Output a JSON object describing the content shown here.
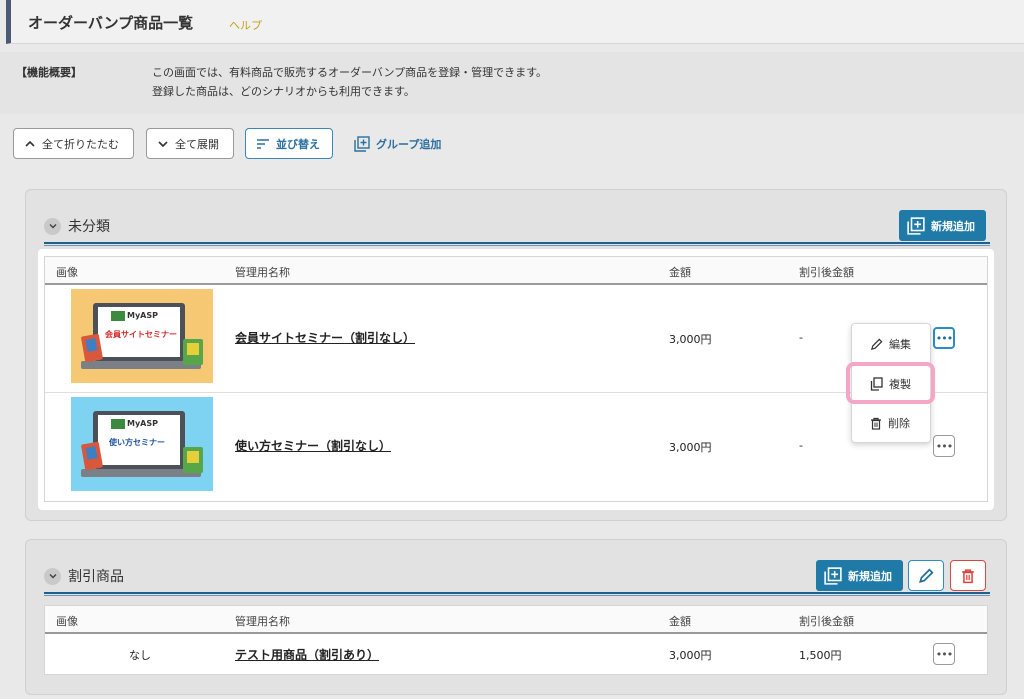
{
  "header": {
    "title": "オーダーバンプ商品一覧",
    "help": "ヘルプ"
  },
  "description": {
    "label": "【機能概要】",
    "lines": [
      "この画面では、有料商品で販売するオーダーバンプ商品を登録・管理できます。",
      "登録した商品は、どのシナリオからも利用できます。"
    ]
  },
  "toolbar": {
    "collapse_all": "全て折りたたむ",
    "expand_all": "全て展開",
    "sort": "並び替え",
    "add_group": "グループ追加"
  },
  "columns": {
    "image": "画像",
    "name": "管理用名称",
    "price": "金額",
    "discount_price": "割引後金額"
  },
  "groups": [
    {
      "title": "未分類",
      "add_label": "新規追加",
      "rows": [
        {
          "thumb_brand": "MyASP",
          "thumb_text": "会員サイトセミナー",
          "name": "会員サイトセミナー（割引なし）",
          "price": "3,000円",
          "discount_price": "-"
        },
        {
          "thumb_brand": "MyASP",
          "thumb_text": "使い方セミナー",
          "name": "使い方セミナー（割引なし）",
          "price": "3,000円",
          "discount_price": "-"
        }
      ]
    },
    {
      "title": "割引商品",
      "add_label": "新規追加",
      "rows": [
        {
          "image": "なし",
          "name": "テスト用商品（割引あり）",
          "price": "3,000円",
          "discount_price": "1,500円"
        }
      ]
    }
  ],
  "menu": {
    "edit": "編集",
    "duplicate": "複製",
    "delete": "削除"
  },
  "colors": {
    "accent": "#1f7aa8",
    "highlight": "#f4a6c6",
    "help": "#c4a21f",
    "delete": "#d9443e"
  }
}
